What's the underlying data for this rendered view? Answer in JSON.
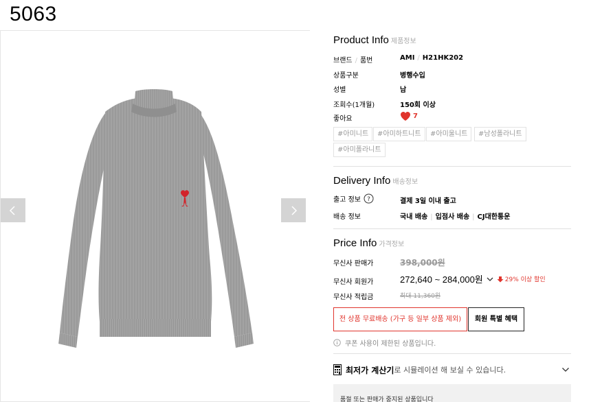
{
  "page_code": "5063",
  "gallery": {
    "prev_icon": "chevron-left-icon",
    "next_icon": "chevron-right-icon",
    "logo_color": "#d2232a"
  },
  "product_info": {
    "title": "Product Info",
    "subtitle": "제품정보",
    "rows": [
      {
        "label": "브랜드",
        "label2": "품번",
        "value": "AMI",
        "value2": "H21HK202"
      },
      {
        "label": "상품구분",
        "value": "병행수입"
      },
      {
        "label": "성별",
        "value": "남"
      },
      {
        "label": "조회수(1개월)",
        "value": "150회 이상"
      },
      {
        "label": "좋아요",
        "value": "7"
      }
    ],
    "like_icon": "heart-icon",
    "tags": [
      "#아미니트",
      "#아미하트니트",
      "#아미울니트",
      "#남성폴라니트",
      "#아미폴라니트"
    ]
  },
  "delivery_info": {
    "title": "Delivery Info",
    "subtitle": "배송정보",
    "ship_label": "출고 정보",
    "ship_value": "결제 3일 이내 출고",
    "method_label": "배송 정보",
    "method_values": [
      "국내 배송",
      "입점사 배송",
      "CJ대한통운"
    ]
  },
  "price_info": {
    "title": "Price Info",
    "subtitle": "가격정보",
    "sale_label": "무신사 판매가",
    "sale_price": "398,000원",
    "member_label": "무신사 회원가",
    "member_price": "272,640 ~ 284,000원",
    "discount": "29% 이상 할인",
    "points_label": "무신사 적립금",
    "points_value": "최대 11,360원",
    "free_ship_button": "전 상품 무료배송 (가구 등 일부 상품 제외)",
    "member_benefit_button": "회원 특별 혜택",
    "coupon_notice": "쿠폰 사용이 제한된 상품입니다.",
    "accent_color": "#e0342c"
  },
  "calculator": {
    "title": "최저가 계산기",
    "desc": "로 시뮬레이션 해 보실 수 있습니다.",
    "icon": "calculator-icon"
  },
  "notice": "품절 또는 판매가 중지된 상품입니다"
}
